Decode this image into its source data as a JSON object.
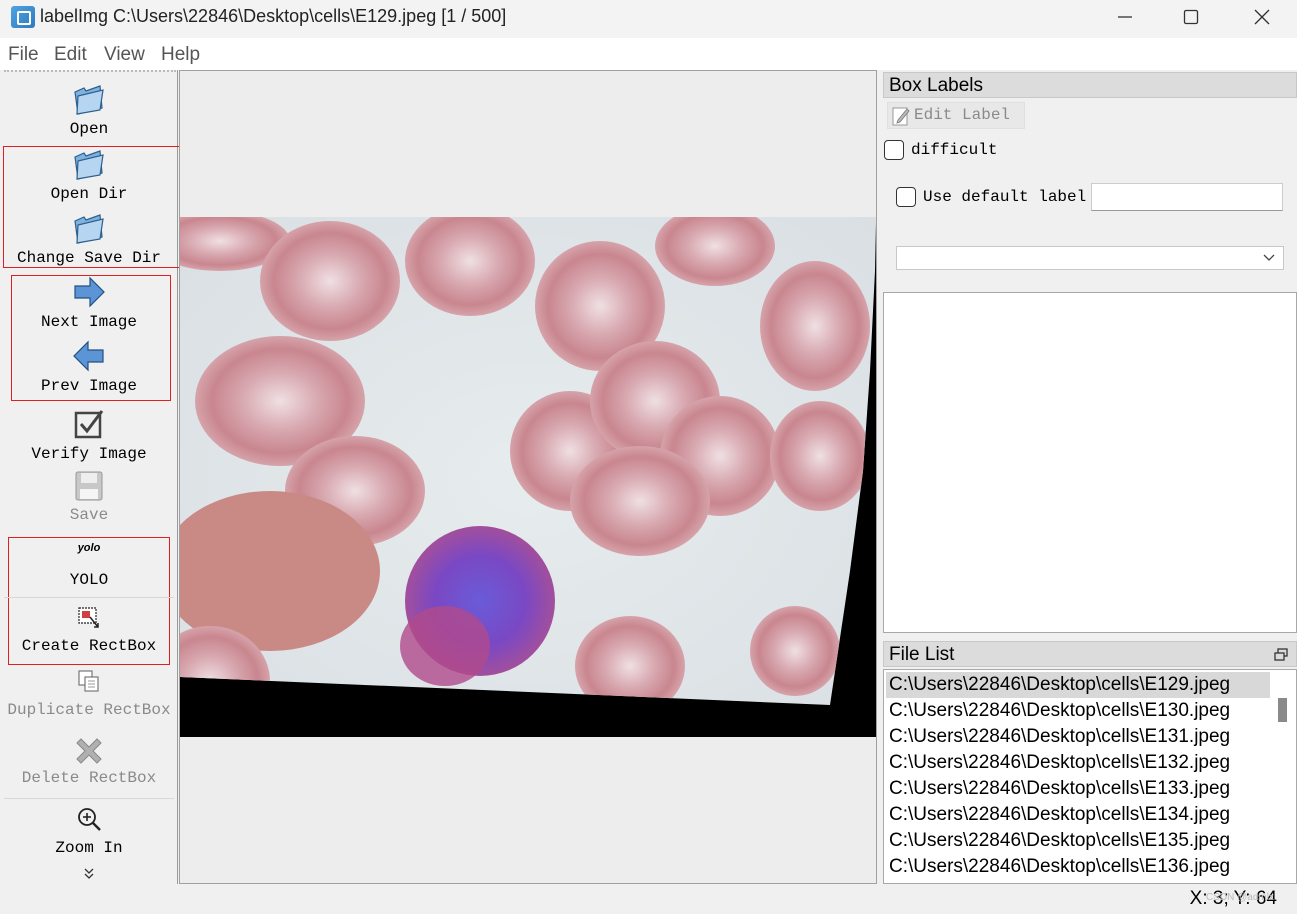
{
  "window": {
    "title": "labelImg C:\\Users\\22846\\Desktop\\cells\\E129.jpeg [1 / 500]",
    "min_glyph": "—",
    "max_glyph": "☐",
    "close_glyph": "✕"
  },
  "menu": {
    "file": "File",
    "edit": "Edit",
    "view": "View",
    "help": "Help"
  },
  "toolbar": {
    "open": "Open",
    "open_dir": "Open Dir",
    "change_save_dir": "Change Save Dir",
    "next_image": "Next Image",
    "prev_image": "Prev Image",
    "verify_image": "Verify Image",
    "save": "Save",
    "yolo_icon_text": "yolo",
    "yolo": "YOLO",
    "create_rectbox": "Create RectBox",
    "duplicate_rectbox": "Duplicate RectBox",
    "delete_rectbox": "Delete RectBox",
    "zoom_in": "Zoom In",
    "more_glyph": "⌄"
  },
  "box_labels": {
    "title": "Box Labels",
    "edit_label": "Edit Label",
    "difficult": "difficult",
    "use_default_label": "Use default label",
    "default_label_value": "",
    "combo_value": ""
  },
  "file_list": {
    "title": "File List",
    "items": [
      "C:\\Users\\22846\\Desktop\\cells\\E129.jpeg",
      "C:\\Users\\22846\\Desktop\\cells\\E130.jpeg",
      "C:\\Users\\22846\\Desktop\\cells\\E131.jpeg",
      "C:\\Users\\22846\\Desktop\\cells\\E132.jpeg",
      "C:\\Users\\22846\\Desktop\\cells\\E133.jpeg",
      "C:\\Users\\22846\\Desktop\\cells\\E134.jpeg",
      "C:\\Users\\22846\\Desktop\\cells\\E135.jpeg",
      "C:\\Users\\22846\\Desktop\\cells\\E136.jpeg"
    ],
    "selected_index": 0
  },
  "status": {
    "coords": "X: 3; Y: 64"
  },
  "watermark": "CSDN @admlx"
}
